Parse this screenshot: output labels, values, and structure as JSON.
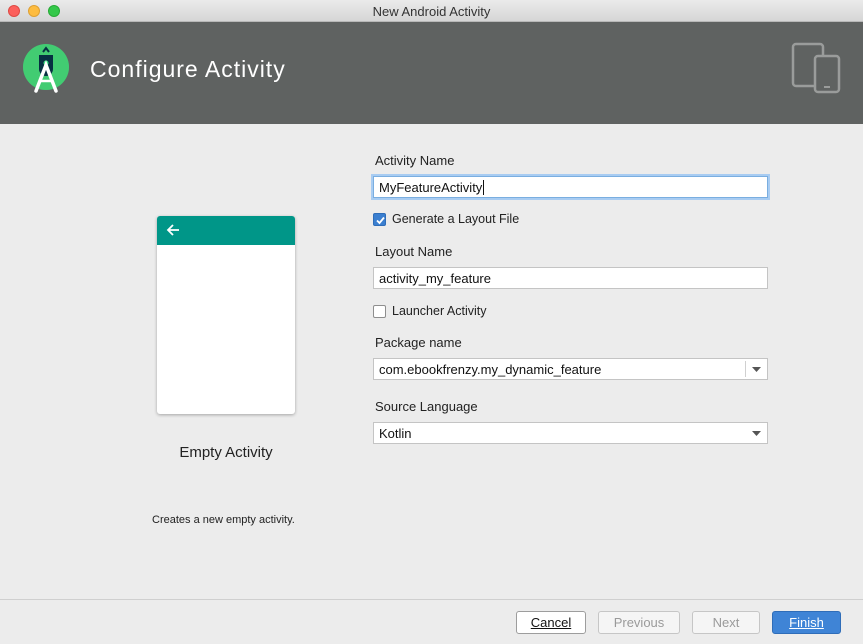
{
  "window": {
    "title": "New Android Activity"
  },
  "banner": {
    "title": "Configure Activity",
    "logo_icon": "android-studio-logo",
    "devices_icon": "devices-icon",
    "background": "#5f6261"
  },
  "preview": {
    "label": "Empty Activity",
    "description": "Creates a new empty activity.",
    "appbar_color": "#009688"
  },
  "form": {
    "activity_name": {
      "label": "Activity Name",
      "value": "MyFeatureActivity"
    },
    "generate_layout": {
      "label": "Generate a Layout File",
      "checked": true
    },
    "layout_name": {
      "label": "Layout Name",
      "value": "activity_my_feature"
    },
    "launcher_activity": {
      "label": "Launcher Activity",
      "checked": false
    },
    "package_name": {
      "label": "Package name",
      "value": "com.ebookfrenzy.my_dynamic_feature"
    },
    "source_language": {
      "label": "Source Language",
      "value": "Kotlin"
    }
  },
  "buttons": {
    "cancel": "Cancel",
    "previous": "Previous",
    "next": "Next",
    "finish": "Finish"
  },
  "colors": {
    "accent": "#3f84d6",
    "teal": "#009688"
  }
}
